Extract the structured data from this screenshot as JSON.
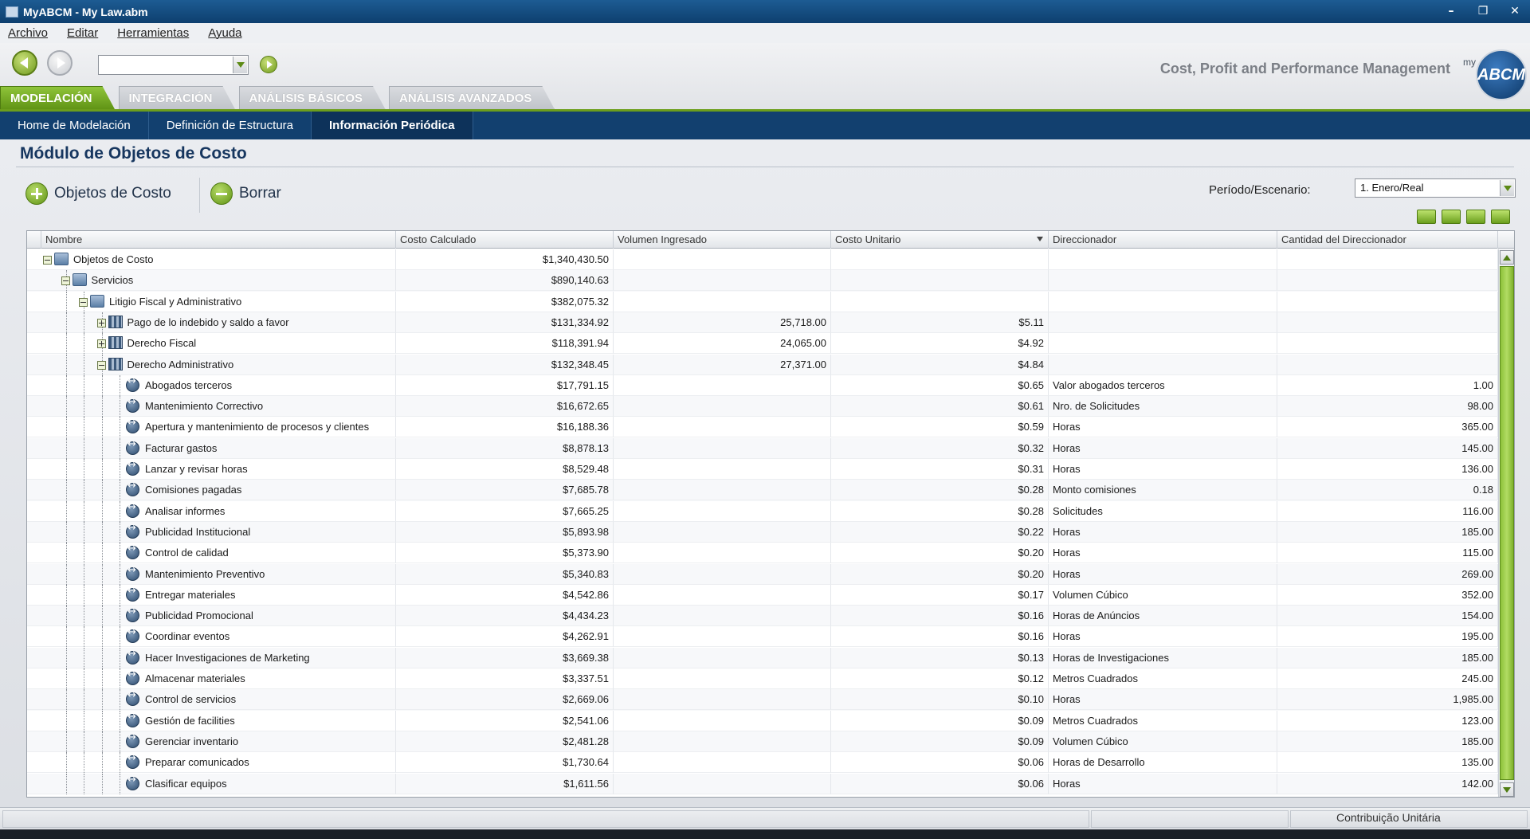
{
  "window": {
    "title": "MyABCM - My Law.abm"
  },
  "menu": [
    "Archivo",
    "Editar",
    "Herramientas",
    "Ayuda"
  ],
  "toolbar": {
    "slogan": "Cost, Profit and Performance Management",
    "logo_my": "my",
    "logo_text": "ABCM"
  },
  "main_tabs": [
    {
      "label": "MODELACIÓN",
      "active": true
    },
    {
      "label": "INTEGRACIÓN",
      "active": false
    },
    {
      "label": "ANÁLISIS BÁSICOS",
      "active": false
    },
    {
      "label": "ANÁLISIS AVANZADOS",
      "active": false
    }
  ],
  "sub_tabs": [
    {
      "label": "Home de Modelación",
      "active": false
    },
    {
      "label": "Definición de Estructura",
      "active": false
    },
    {
      "label": "Información Periódica",
      "active": true
    }
  ],
  "module": {
    "title": "Módulo de Objetos de Costo",
    "add_label": "Objetos de Costo",
    "delete_label": "Borrar",
    "period_label": "Período/Escenario:",
    "period_value": "1. Enero/Real"
  },
  "grid": {
    "columns": [
      "Nombre",
      "Costo Calculado",
      "Volumen Ingresado",
      "Costo Unitario",
      "Direccionador",
      "Cantidad del Direccionador"
    ],
    "rows": [
      {
        "level": 0,
        "icon": "folder",
        "expander": "minus",
        "name": "Objetos de Costo",
        "costo": "$1,340,430.50",
        "volumen": "",
        "unitario": "",
        "direccionador": "",
        "cantidad": ""
      },
      {
        "level": 1,
        "icon": "folder",
        "expander": "minus",
        "name": "Servicios",
        "costo": "$890,140.63",
        "volumen": "",
        "unitario": "",
        "direccionador": "",
        "cantidad": ""
      },
      {
        "level": 2,
        "icon": "folder",
        "expander": "minus",
        "name": "Litigio Fiscal y Administrativo",
        "costo": "$382,075.32",
        "volumen": "",
        "unitario": "",
        "direccionador": "",
        "cantidad": ""
      },
      {
        "level": 3,
        "icon": "bars",
        "expander": "plus",
        "name": "Pago de lo indebido y saldo a favor",
        "costo": "$131,334.92",
        "volumen": "25,718.00",
        "unitario": "$5.11",
        "direccionador": "",
        "cantidad": ""
      },
      {
        "level": 3,
        "icon": "bars",
        "expander": "plus",
        "name": "Derecho Fiscal",
        "costo": "$118,391.94",
        "volumen": "24,065.00",
        "unitario": "$4.92",
        "direccionador": "",
        "cantidad": ""
      },
      {
        "level": 3,
        "icon": "bars",
        "expander": "minus",
        "name": "Derecho Administrativo",
        "costo": "$132,348.45",
        "volumen": "27,371.00",
        "unitario": "$4.84",
        "direccionador": "",
        "cantidad": ""
      },
      {
        "level": 4,
        "icon": "act",
        "expander": "",
        "name": "Abogados terceros",
        "costo": "$17,791.15",
        "volumen": "",
        "unitario": "$0.65",
        "direccionador": "Valor abogados terceros",
        "cantidad": "1.00"
      },
      {
        "level": 4,
        "icon": "act",
        "expander": "",
        "name": "Mantenimiento Correctivo",
        "costo": "$16,672.65",
        "volumen": "",
        "unitario": "$0.61",
        "direccionador": "Nro. de Solicitudes",
        "cantidad": "98.00"
      },
      {
        "level": 4,
        "icon": "act",
        "expander": "",
        "name": "Apertura y mantenimiento de procesos y clientes",
        "costo": "$16,188.36",
        "volumen": "",
        "unitario": "$0.59",
        "direccionador": "Horas",
        "cantidad": "365.00"
      },
      {
        "level": 4,
        "icon": "act",
        "expander": "",
        "name": "Facturar gastos",
        "costo": "$8,878.13",
        "volumen": "",
        "unitario": "$0.32",
        "direccionador": "Horas",
        "cantidad": "145.00"
      },
      {
        "level": 4,
        "icon": "act",
        "expander": "",
        "name": "Lanzar y revisar horas",
        "costo": "$8,529.48",
        "volumen": "",
        "unitario": "$0.31",
        "direccionador": "Horas",
        "cantidad": "136.00"
      },
      {
        "level": 4,
        "icon": "act",
        "expander": "",
        "name": "Comisiones pagadas",
        "costo": "$7,685.78",
        "volumen": "",
        "unitario": "$0.28",
        "direccionador": "Monto comisiones",
        "cantidad": "0.18"
      },
      {
        "level": 4,
        "icon": "act",
        "expander": "",
        "name": "Analisar informes",
        "costo": "$7,665.25",
        "volumen": "",
        "unitario": "$0.28",
        "direccionador": "Solicitudes",
        "cantidad": "116.00"
      },
      {
        "level": 4,
        "icon": "act",
        "expander": "",
        "name": "Publicidad Institucional",
        "costo": "$5,893.98",
        "volumen": "",
        "unitario": "$0.22",
        "direccionador": "Horas",
        "cantidad": "185.00"
      },
      {
        "level": 4,
        "icon": "act",
        "expander": "",
        "name": "Control de calidad",
        "costo": "$5,373.90",
        "volumen": "",
        "unitario": "$0.20",
        "direccionador": "Horas",
        "cantidad": "115.00"
      },
      {
        "level": 4,
        "icon": "act",
        "expander": "",
        "name": "Mantenimiento Preventivo",
        "costo": "$5,340.83",
        "volumen": "",
        "unitario": "$0.20",
        "direccionador": "Horas",
        "cantidad": "269.00"
      },
      {
        "level": 4,
        "icon": "act",
        "expander": "",
        "name": "Entregar materiales",
        "costo": "$4,542.86",
        "volumen": "",
        "unitario": "$0.17",
        "direccionador": "Volumen Cúbico",
        "cantidad": "352.00"
      },
      {
        "level": 4,
        "icon": "act",
        "expander": "",
        "name": "Publicidad Promocional",
        "costo": "$4,434.23",
        "volumen": "",
        "unitario": "$0.16",
        "direccionador": "Horas de Anúncios",
        "cantidad": "154.00"
      },
      {
        "level": 4,
        "icon": "act",
        "expander": "",
        "name": "Coordinar eventos",
        "costo": "$4,262.91",
        "volumen": "",
        "unitario": "$0.16",
        "direccionador": "Horas",
        "cantidad": "195.00"
      },
      {
        "level": 4,
        "icon": "act",
        "expander": "",
        "name": "Hacer Investigaciones de Marketing",
        "costo": "$3,669.38",
        "volumen": "",
        "unitario": "$0.13",
        "direccionador": "Horas de Investigaciones",
        "cantidad": "185.00"
      },
      {
        "level": 4,
        "icon": "act",
        "expander": "",
        "name": "Almacenar materiales",
        "costo": "$3,337.51",
        "volumen": "",
        "unitario": "$0.12",
        "direccionador": "Metros Cuadrados",
        "cantidad": "245.00"
      },
      {
        "level": 4,
        "icon": "act",
        "expander": "",
        "name": "Control de servicios",
        "costo": "$2,669.06",
        "volumen": "",
        "unitario": "$0.10",
        "direccionador": "Horas",
        "cantidad": "1,985.00"
      },
      {
        "level": 4,
        "icon": "act",
        "expander": "",
        "name": "Gestión de facilities",
        "costo": "$2,541.06",
        "volumen": "",
        "unitario": "$0.09",
        "direccionador": "Metros Cuadrados",
        "cantidad": "123.00"
      },
      {
        "level": 4,
        "icon": "act",
        "expander": "",
        "name": "Gerenciar inventario",
        "costo": "$2,481.28",
        "volumen": "",
        "unitario": "$0.09",
        "direccionador": "Volumen Cúbico",
        "cantidad": "185.00"
      },
      {
        "level": 4,
        "icon": "act",
        "expander": "",
        "name": "Preparar comunicados",
        "costo": "$1,730.64",
        "volumen": "",
        "unitario": "$0.06",
        "direccionador": "Horas de Desarrollo",
        "cantidad": "135.00"
      },
      {
        "level": 4,
        "icon": "act",
        "expander": "",
        "name": "Clasificar equipos",
        "costo": "$1,611.56",
        "volumen": "",
        "unitario": "$0.06",
        "direccionador": "Horas",
        "cantidad": "142.00"
      }
    ]
  },
  "status": {
    "right_text": "Contribuição Unitária"
  }
}
